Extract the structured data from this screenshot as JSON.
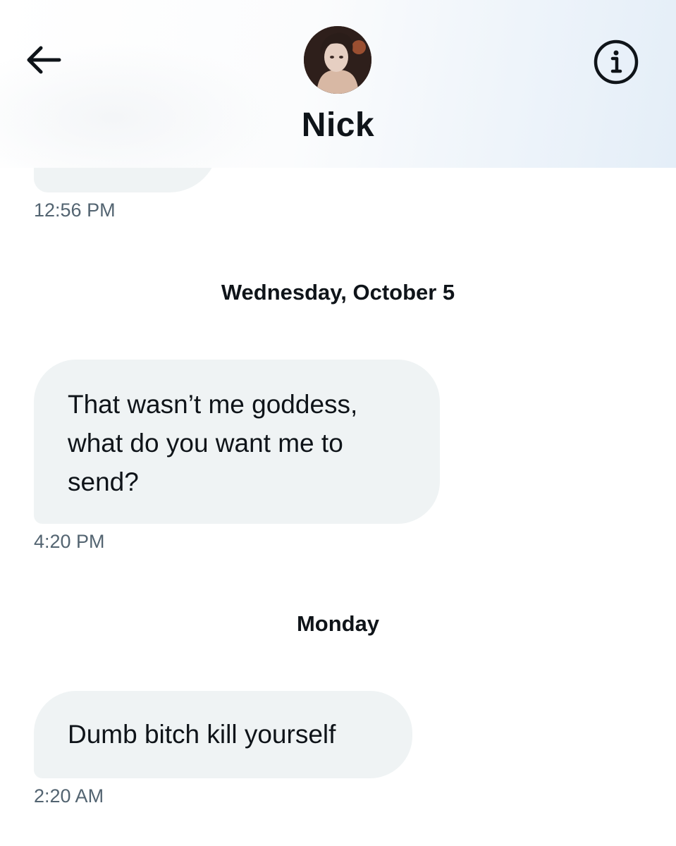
{
  "header": {
    "contact_name": "Nick",
    "back_icon": "arrow-left-icon",
    "info_icon": "info-circle-icon"
  },
  "conversation": {
    "previous_message_time": "12:56 PM",
    "groups": [
      {
        "day_label": "Wednesday, October 5",
        "messages": [
          {
            "text": "That wasn’t me goddess, what do you want me to send?",
            "time": "4:20 PM"
          }
        ]
      },
      {
        "day_label": "Monday",
        "messages": [
          {
            "text": "Dumb bitch kill yourself",
            "time": "2:20 AM"
          }
        ]
      }
    ]
  },
  "colors": {
    "bubble_background": "#eff3f4",
    "text_primary": "#0f1419",
    "text_secondary": "#536471"
  }
}
